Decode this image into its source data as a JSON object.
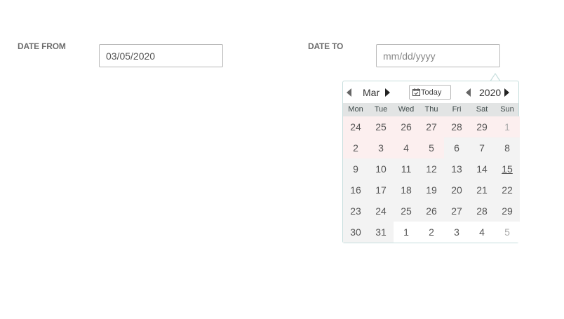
{
  "form": {
    "from_label": "DATE FROM",
    "from_value": "03/05/2020",
    "to_label": "DATE TO",
    "to_placeholder": "mm/dd/yyyy"
  },
  "calendar": {
    "month": "Mar",
    "year": "2020",
    "today_label": "Today",
    "weekdays": [
      "Mon",
      "Tue",
      "Wed",
      "Thu",
      "Fri",
      "Sat",
      "Sun"
    ],
    "weeks": [
      [
        "24",
        "25",
        "26",
        "27",
        "28",
        "29",
        "1"
      ],
      [
        "2",
        "3",
        "4",
        "5",
        "6",
        "7",
        "8"
      ],
      [
        "9",
        "10",
        "11",
        "12",
        "13",
        "14",
        "15"
      ],
      [
        "16",
        "17",
        "18",
        "19",
        "20",
        "21",
        "22"
      ],
      [
        "23",
        "24",
        "25",
        "26",
        "27",
        "28",
        "29"
      ],
      [
        "30",
        "31",
        "1",
        "2",
        "3",
        "4",
        "5"
      ]
    ],
    "colors": {
      "range_highlight": "#fcefef",
      "weekend_shade": "#f3f3f3",
      "border": "#c6dedd",
      "weekday_header_bg": "#e2e4e4"
    },
    "icons": [
      "chevron-left-icon",
      "chevron-right-icon",
      "calendar-check-icon"
    ]
  }
}
